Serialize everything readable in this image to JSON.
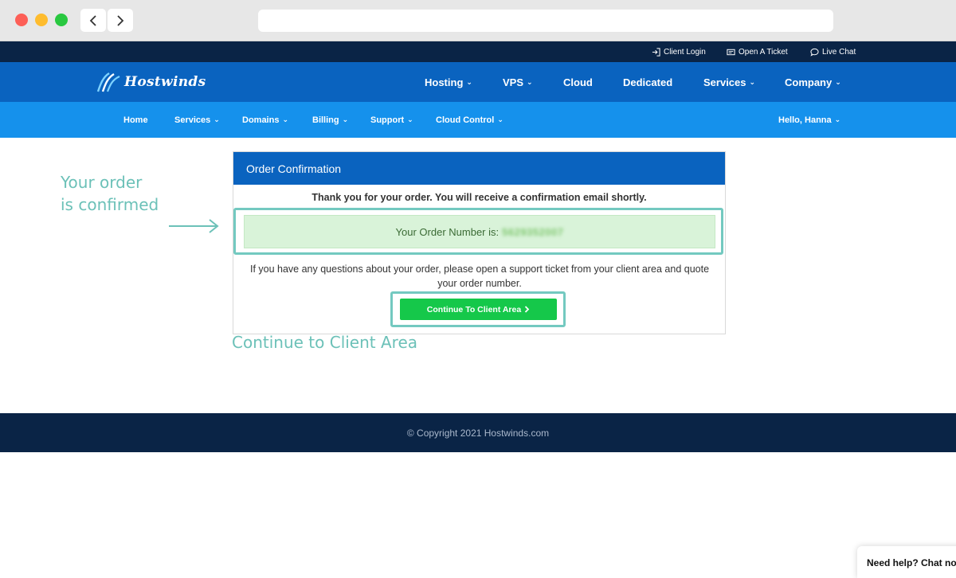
{
  "utility_bar": {
    "client_login": "Client Login",
    "open_ticket": "Open A Ticket",
    "live_chat": "Live Chat"
  },
  "brand": {
    "logo_text": "Hostwinds"
  },
  "main_nav": {
    "items": [
      {
        "label": "Hosting",
        "dropdown": true
      },
      {
        "label": "VPS",
        "dropdown": true
      },
      {
        "label": "Cloud",
        "dropdown": false
      },
      {
        "label": "Dedicated",
        "dropdown": false
      },
      {
        "label": "Services",
        "dropdown": true
      },
      {
        "label": "Company",
        "dropdown": true
      }
    ]
  },
  "sub_nav": {
    "items": [
      {
        "label": "Home",
        "dropdown": false
      },
      {
        "label": "Services",
        "dropdown": true
      },
      {
        "label": "Domains",
        "dropdown": true
      },
      {
        "label": "Billing",
        "dropdown": true
      },
      {
        "label": "Support",
        "dropdown": true
      },
      {
        "label": "Cloud Control",
        "dropdown": true
      }
    ],
    "greeting": "Hello, Hanna"
  },
  "annotations": {
    "order_confirmed_line1": "Your order",
    "order_confirmed_line2": "is confirmed",
    "continue": "Continue to Client Area",
    "color": "#6cc1b8"
  },
  "panel": {
    "title": "Order Confirmation",
    "thanks": "Thank you for your order. You will receive a confirmation email shortly.",
    "order_label": "Your Order Number is:",
    "order_number": "5629352007",
    "questions": "If you have any questions about your order, please open a support ticket from your client area and quote your order number.",
    "cta_label": "Continue To Client Area"
  },
  "footer": {
    "copyright": "© Copyright 2021 Hostwinds.com"
  },
  "chat_widget": {
    "label": "Need help? Chat now"
  },
  "colors": {
    "navy": "#0a2446",
    "brand_blue": "#0a63bf",
    "sub_blue": "#1591ec",
    "cta_green": "#15c84a",
    "success_bg": "#d9f3d9",
    "highlight_teal": "#73c9c0"
  }
}
